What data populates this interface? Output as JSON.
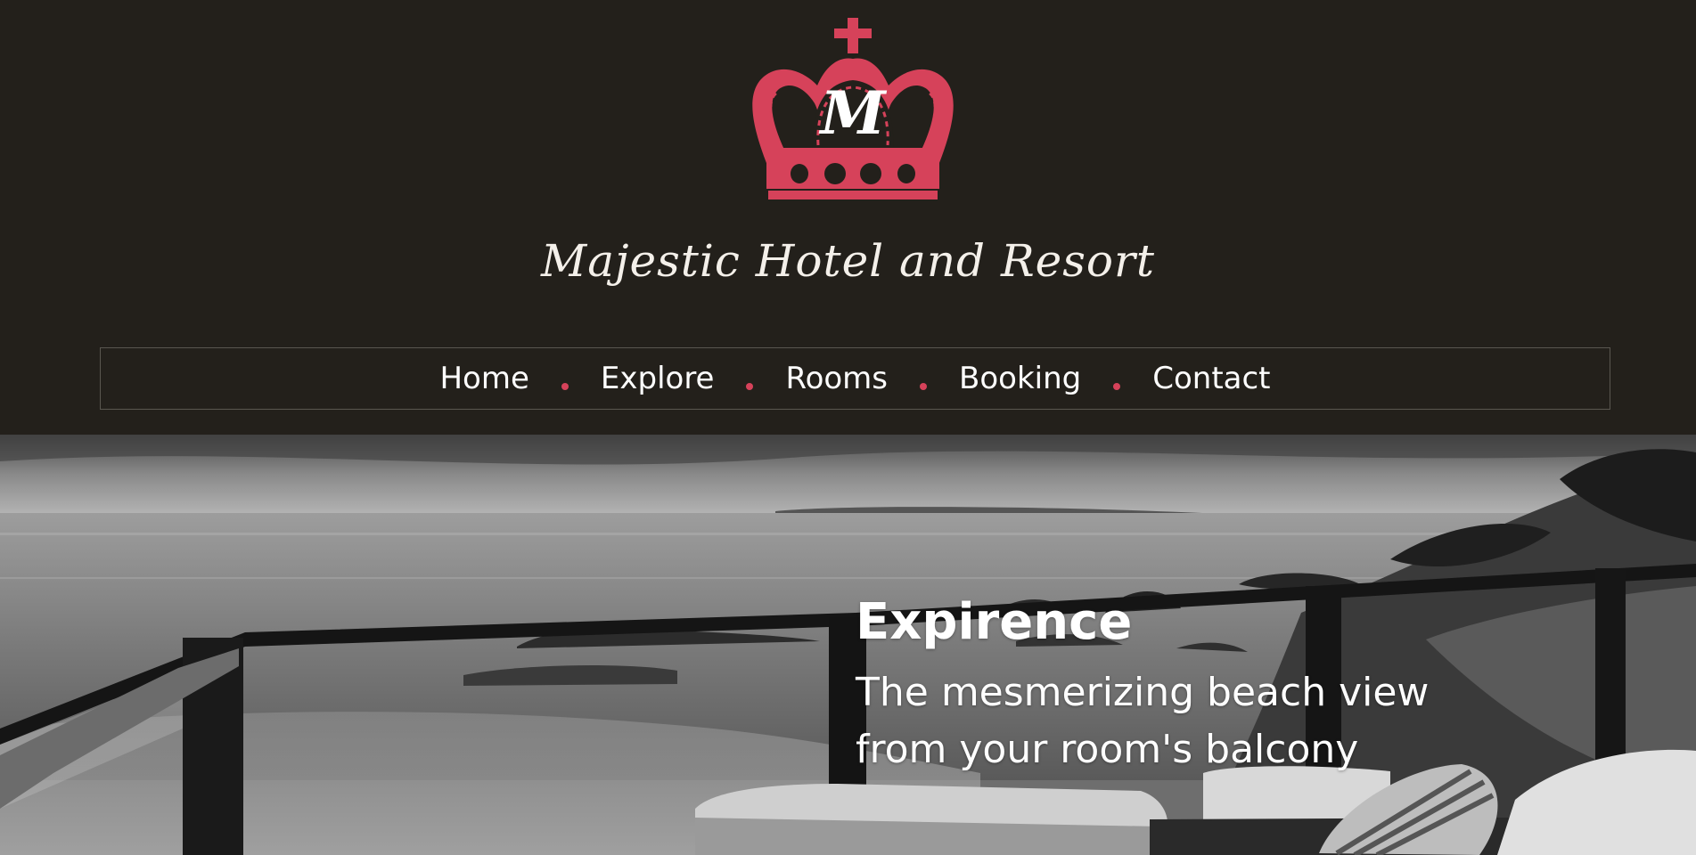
{
  "header": {
    "logo_monogram": "M",
    "brand_name": "Majestic Hotel and Resort"
  },
  "nav": {
    "items": [
      {
        "label": "Home"
      },
      {
        "label": "Explore"
      },
      {
        "label": "Rooms"
      },
      {
        "label": "Booking"
      },
      {
        "label": "Contact"
      }
    ]
  },
  "hero": {
    "title": "Expirence",
    "subtitle": "The mesmerizing beach view from your room's balcony"
  },
  "colors": {
    "background": "#23201b",
    "accent": "#d6425a",
    "text": "#ffffff"
  }
}
